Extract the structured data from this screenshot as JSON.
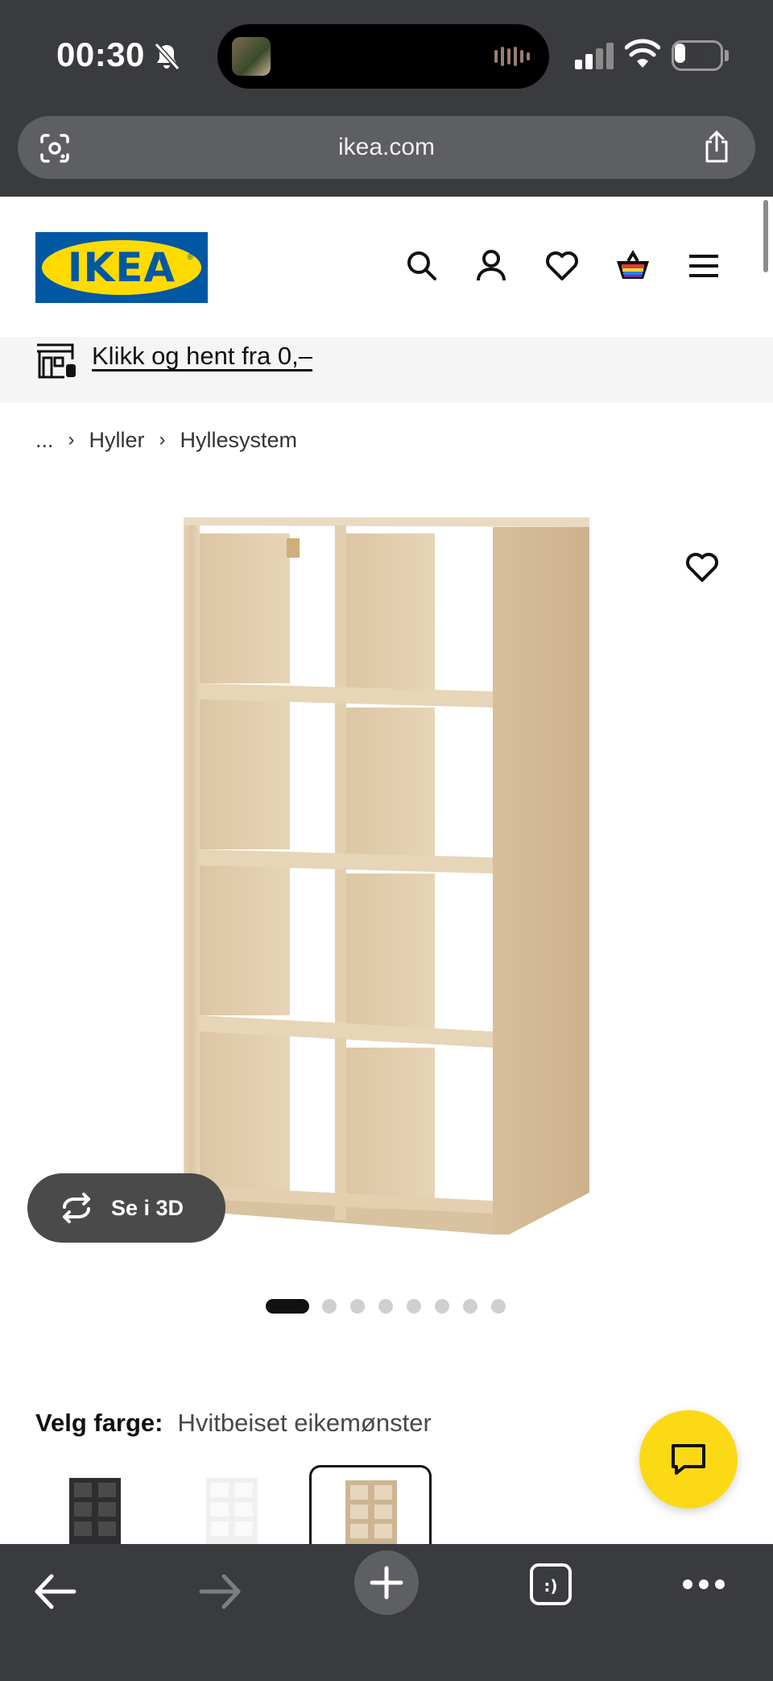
{
  "status_bar": {
    "time": "00:30",
    "battery": "21"
  },
  "browser": {
    "url": "ikea.com"
  },
  "header": {
    "logo_text": "IKEA"
  },
  "banner": {
    "text": "Klikk og hent fra 0,–"
  },
  "breadcrumb": [
    {
      "label": "..."
    },
    {
      "label": "Hyller"
    },
    {
      "label": "Hyllesystem"
    }
  ],
  "product": {
    "view_3d_label": "Se i 3D",
    "image_count": 8,
    "active_image": 1
  },
  "color_picker": {
    "label": "Velg farge:",
    "selected": "Hvitbeiset eikemønster",
    "swatches": [
      "black-brown",
      "white",
      "white-stained-oak"
    ]
  },
  "colors": {
    "brand_blue": "#0058a3",
    "brand_yellow": "#ffdb00",
    "chat_yellow": "#fbd914",
    "chrome": "#3a3b3e"
  }
}
